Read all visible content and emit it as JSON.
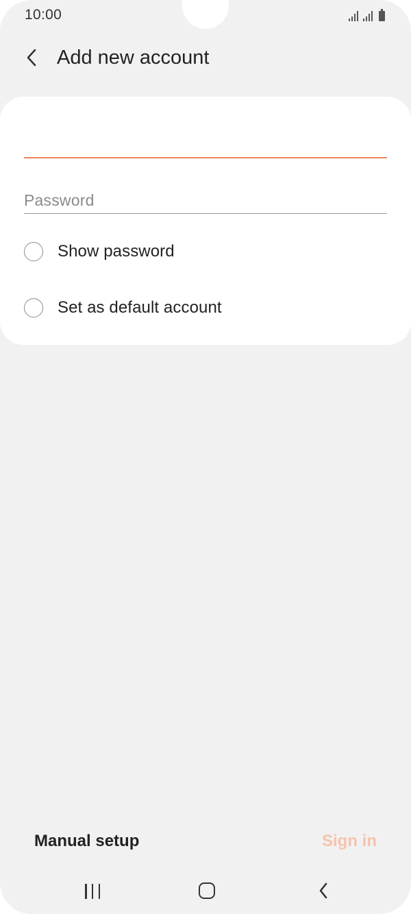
{
  "status_bar": {
    "time": "10:00",
    "icons": [
      "signal-icon",
      "signal-icon",
      "battery-icon"
    ]
  },
  "app_bar": {
    "back_icon": "back-arrow-icon",
    "title": "Add new account"
  },
  "form": {
    "email": {
      "value": "",
      "placeholder": "",
      "underline_color": "#f0845a"
    },
    "password": {
      "value": "",
      "placeholder": "Password"
    },
    "options": [
      {
        "label": "Show password",
        "checked": false
      },
      {
        "label": "Set as default account",
        "checked": false
      }
    ]
  },
  "actions": {
    "manual_setup_label": "Manual setup",
    "sign_in_label": "Sign in",
    "sign_in_enabled": false,
    "accent_color": "#f0845a"
  },
  "nav_bar": {
    "icons": [
      "recents-icon",
      "home-icon",
      "back-icon"
    ]
  }
}
